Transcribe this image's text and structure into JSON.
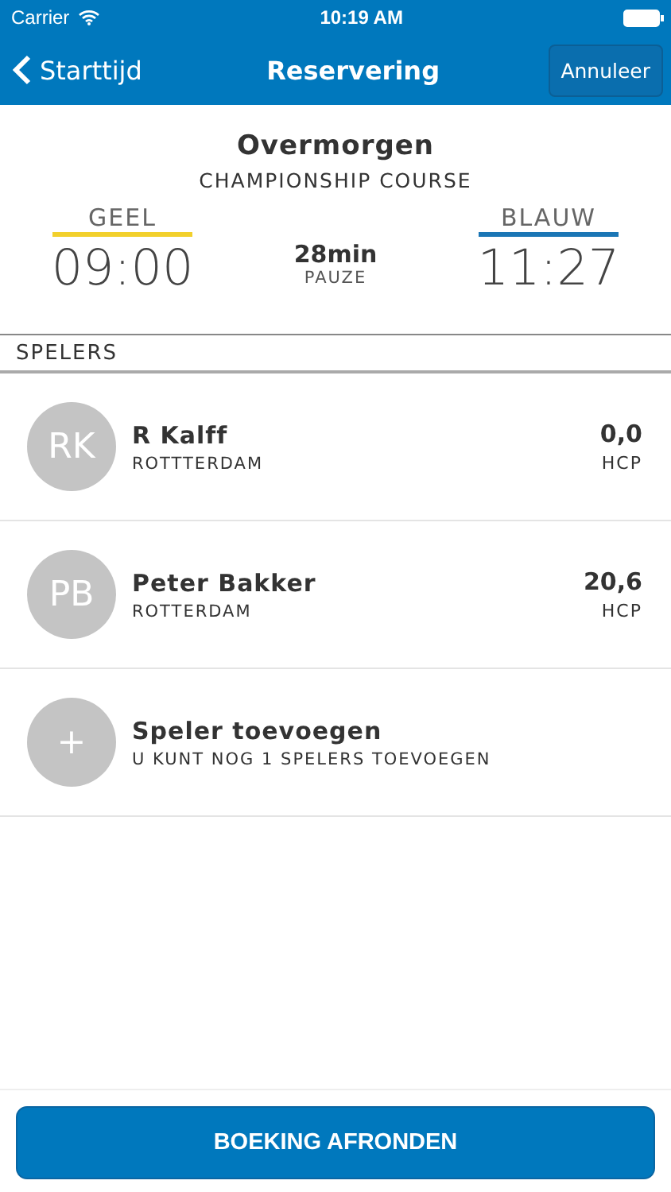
{
  "status_bar": {
    "carrier": "Carrier",
    "time": "10:19 AM"
  },
  "nav": {
    "back": "Starttijd",
    "title": "Reservering",
    "action": "Annuleer"
  },
  "booking": {
    "day": "Overmorgen",
    "course": "CHAMPIONSHIP COURSE",
    "tees": [
      {
        "name": "GEEL",
        "time": "09:00",
        "color": "#f2d02c"
      },
      {
        "name": "BLAUW",
        "time": "11:27",
        "color": "#1b76b5"
      }
    ],
    "pause": {
      "value": "28min",
      "label": "PAUZE"
    }
  },
  "section": "SPELERS",
  "players": [
    {
      "kind": "player",
      "initials": "RK",
      "name": "R Kalff",
      "city": "ROTTTERDAM",
      "hcp": "0,0",
      "hcp_label": "HCP"
    },
    {
      "kind": "player",
      "initials": "PB",
      "name": "Peter Bakker",
      "city": "ROTTERDAM",
      "hcp": "20,6",
      "hcp_label": "HCP"
    },
    {
      "kind": "add",
      "icon": "+",
      "name": "Speler toevoegen",
      "city": "U KUNT NOG 1 SPELERS TOEVOEGEN"
    }
  ],
  "submit": "BOEKING AFRONDEN"
}
